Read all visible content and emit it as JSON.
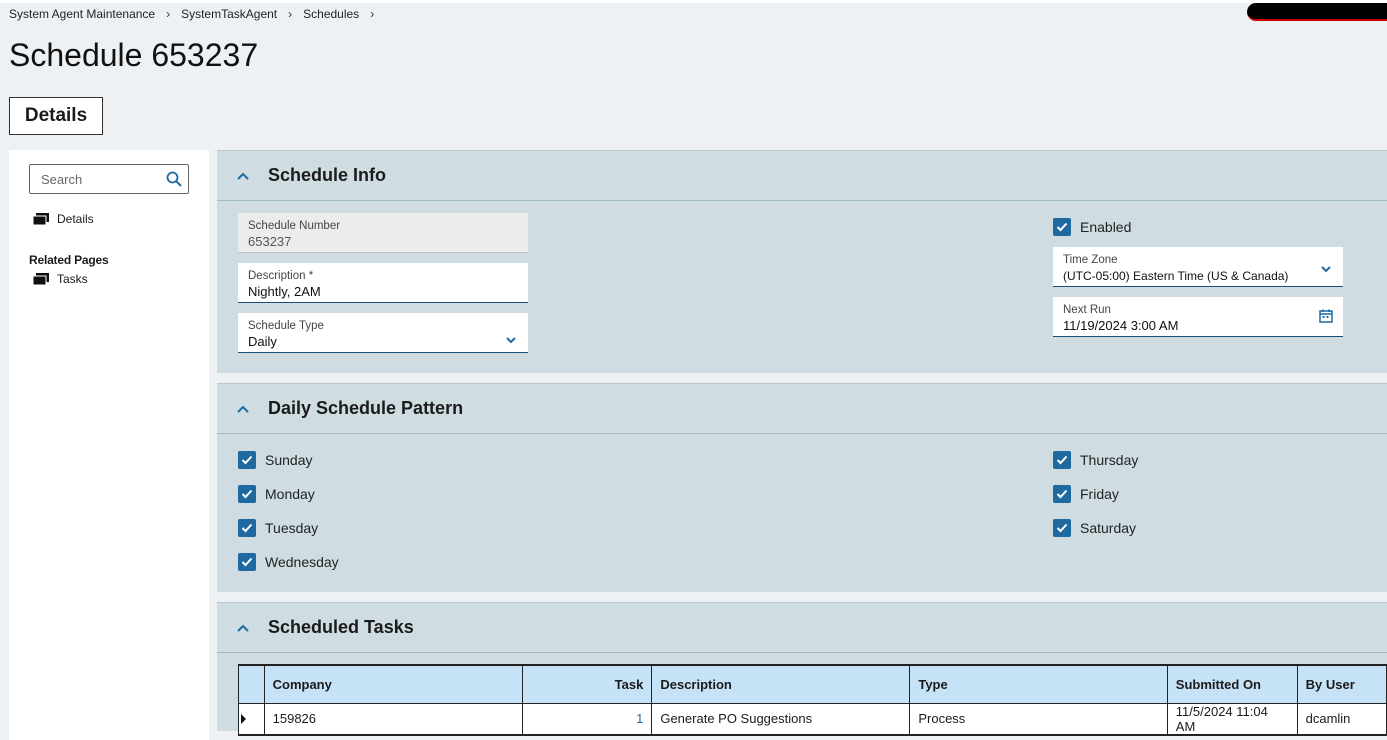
{
  "breadcrumb": [
    "System Agent Maintenance",
    "SystemTaskAgent",
    "Schedules"
  ],
  "page_title": "Schedule 653237",
  "tab": {
    "label": "Details"
  },
  "sidebar": {
    "search_placeholder": "Search",
    "details_link": "Details",
    "related_heading": "Related Pages",
    "tasks_link": "Tasks"
  },
  "schedule_info": {
    "title": "Schedule Info",
    "schedule_number": {
      "label": "Schedule Number",
      "value": "653237"
    },
    "description": {
      "label": "Description *",
      "value": "Nightly, 2AM"
    },
    "schedule_type": {
      "label": "Schedule Type",
      "value": "Daily"
    },
    "enabled": {
      "label": "Enabled",
      "checked": true
    },
    "time_zone": {
      "label": "Time Zone",
      "value": "(UTC-05:00) Eastern Time (US & Canada)"
    },
    "next_run": {
      "label": "Next Run",
      "value": "11/19/2024 3:00 AM"
    }
  },
  "daily_pattern": {
    "title": "Daily Schedule Pattern",
    "days": [
      {
        "label": "Sunday",
        "checked": true
      },
      {
        "label": "Monday",
        "checked": true
      },
      {
        "label": "Tuesday",
        "checked": true
      },
      {
        "label": "Wednesday",
        "checked": true
      },
      {
        "label": "Thursday",
        "checked": true
      },
      {
        "label": "Friday",
        "checked": true
      },
      {
        "label": "Saturday",
        "checked": true
      }
    ]
  },
  "scheduled_tasks": {
    "title": "Scheduled Tasks",
    "columns": [
      "Company",
      "Task",
      "Description",
      "Type",
      "Submitted On",
      "By User"
    ],
    "rows": [
      {
        "company": "159826",
        "task": "1",
        "description": "Generate PO Suggestions",
        "type": "Process",
        "submitted_on": "11/5/2024 11:04 AM",
        "by_user": "dcamlin"
      }
    ]
  },
  "colors": {
    "accent": "#1e6aa0",
    "section_bg": "#cfdde2",
    "header_cell_bg": "#c6e2f6",
    "page_bg": "#eef1f4"
  }
}
